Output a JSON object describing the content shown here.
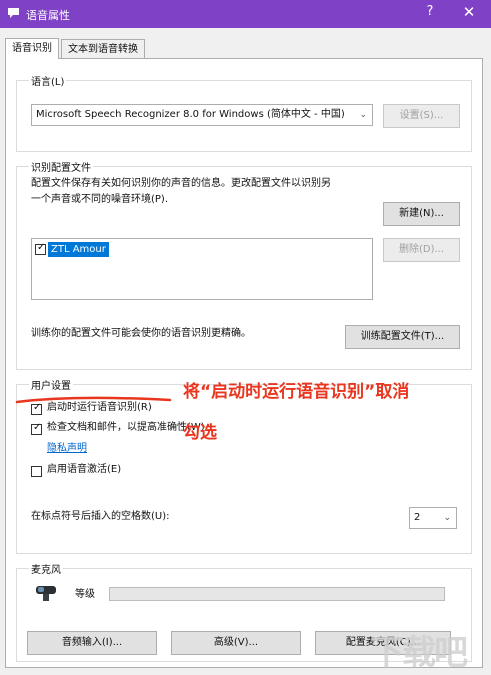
{
  "window": {
    "title": "语音属性",
    "help_glyph": "?",
    "close_glyph": "✕"
  },
  "tabs": [
    {
      "label": "语音识别",
      "active": true
    },
    {
      "label": "文本到语音转换",
      "active": false
    }
  ],
  "language": {
    "legend": "语言(L)",
    "selected": "Microsoft Speech Recognizer 8.0 for Windows (简体中文 - 中国)",
    "settings_button": "设置(S)..."
  },
  "profiles": {
    "legend": "识别配置文件",
    "description": [
      "配置文件保存有关如何识别你的声音的信息。更改配置文件以识别另",
      "一个声音或不同的噪音环境(P)."
    ],
    "new_button": "新建(N)...",
    "delete_button": "删除(D)...",
    "items": [
      {
        "name": "ZTL Amour",
        "checked": true,
        "selected": true
      }
    ],
    "train_text": "训练你的配置文件可能会使你的语音识别更精确。",
    "train_button": "训练配置文件(T)..."
  },
  "user_settings": {
    "legend": "用户设置",
    "run_at_startup": {
      "label": "启动时运行语音识别(R)",
      "checked": true
    },
    "review_docs": {
      "label": "检查文档和邮件，以提高准确性(W)",
      "checked": true
    },
    "privacy_link": "隐私声明",
    "voice_activation": {
      "label": "启用语音激活(E)",
      "checked": false
    },
    "spaces_label": "在标点符号后插入的空格数(U):",
    "spaces_value": "2"
  },
  "microphone": {
    "legend": "麦克风",
    "level_label": "等级",
    "level_fraction": 0,
    "audio_input_button": "音频输入(I)...",
    "advanced_button": "高级(V)...",
    "configure_button": "配置麦克风(C)..."
  },
  "annotation": {
    "line1": "将“启动时运行语音识别”取消",
    "line2": "勾选",
    "color": "#e8361f"
  },
  "watermark": "下载吧",
  "colors": {
    "titlebar": "#7f41c6",
    "selection": "#0078d7",
    "link": "#0066cc"
  }
}
